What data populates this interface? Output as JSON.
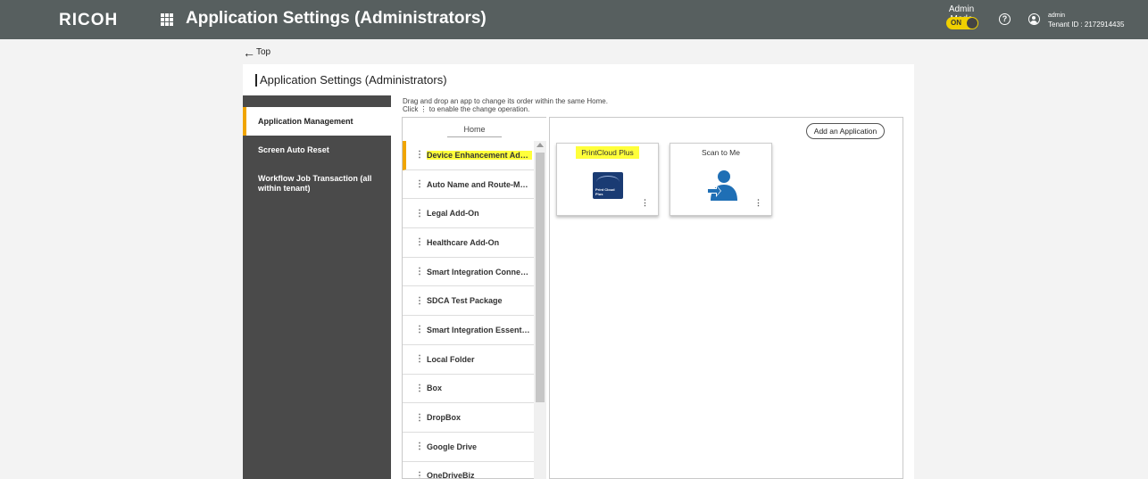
{
  "header": {
    "logo": "RICOH",
    "title": "Application Settings (Administrators)",
    "admin_mode_label": "Admin Mode",
    "admin_mode_state": "ON",
    "user_name": "admin",
    "tenant_id": "Tenant ID : 2172914435",
    "icons": {
      "apps": "apps-grid-icon",
      "help": "help-icon",
      "user": "user-icon"
    }
  },
  "back_link": "Top",
  "page_title": "Application Settings (Administrators)",
  "sidebar": {
    "items": [
      {
        "label": "Application Management",
        "active": true
      },
      {
        "label": "Screen Auto Reset",
        "active": false
      },
      {
        "label": "Workflow Job Transaction (all within tenant)",
        "active": false
      }
    ]
  },
  "hint": {
    "line1": "Drag and drop an app to change its order within the same Home.",
    "line2": "Click  ⋮  to enable the change operation."
  },
  "home": {
    "title": "Home",
    "items": [
      "Device Enhancement Add-On",
      "Auto Name and Route-Module",
      "Legal Add-On",
      "Healthcare Add-On",
      "Smart Integration Connector",
      "SDCA Test Package",
      "Smart Integration Essentials",
      "Local Folder",
      "Box",
      "DropBox",
      "Google Drive",
      "OneDriveBiz"
    ]
  },
  "apps_area": {
    "add_button": "Add an Application",
    "tiles": [
      {
        "name": "PrintCloud Plus",
        "logo_text": "Print Cloud Plus"
      },
      {
        "name": "Scan to Me"
      }
    ]
  },
  "colors": {
    "header": "#575f5f",
    "accent": "#f0a500",
    "toggle": "#f0d000",
    "highlight": "#ffff3a"
  }
}
